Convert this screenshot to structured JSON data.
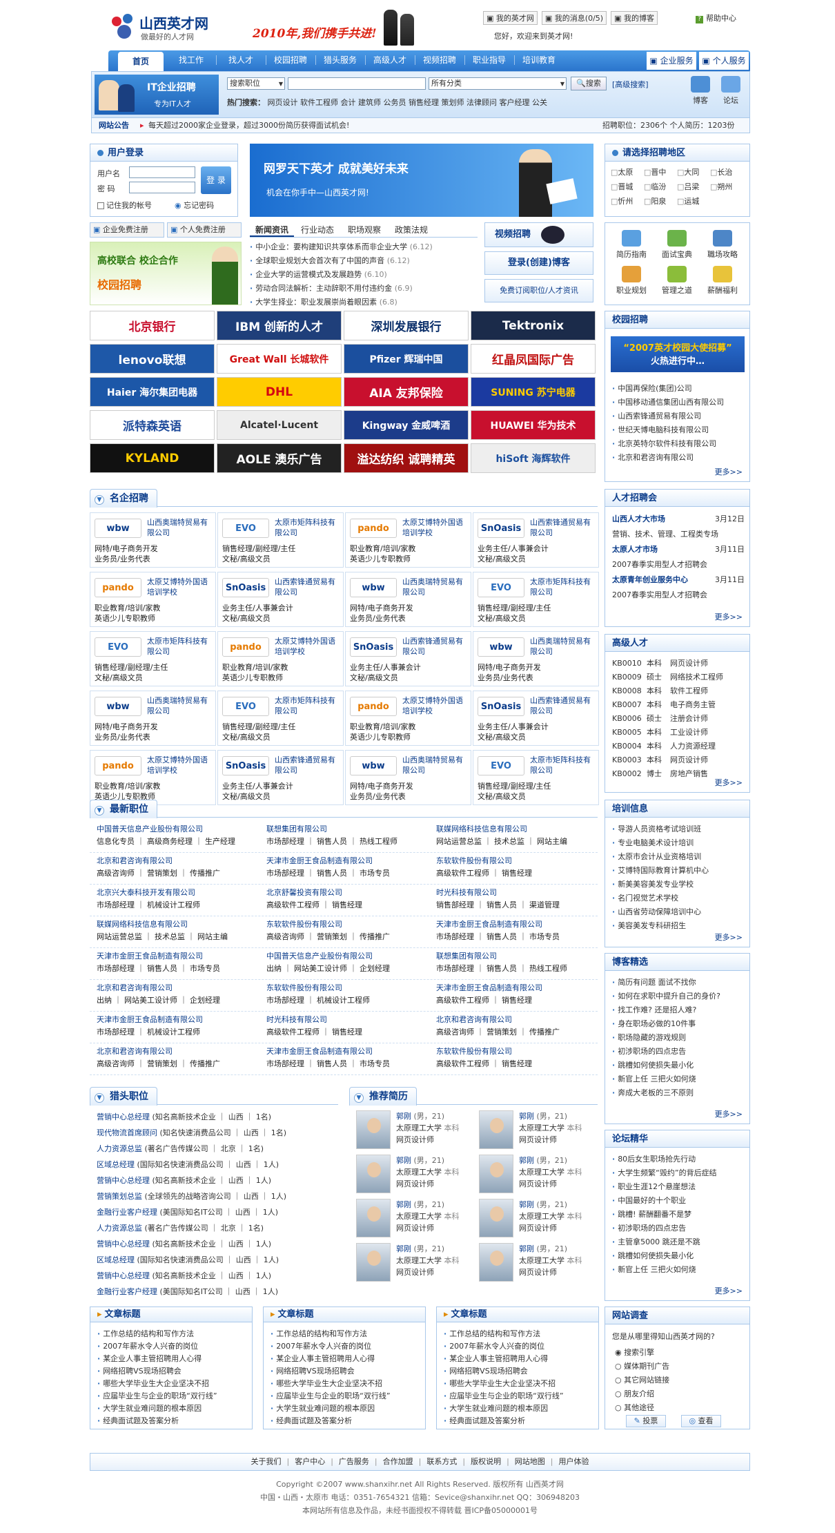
{
  "header": {
    "logo_text": "山西英才网",
    "slogan": "做最好的人才网",
    "banner_text": "2010年,我们携手共进!",
    "top_links": [
      "我的英才网",
      "我的消息(0/5)",
      "我的博客"
    ],
    "help": "帮助中心",
    "welcome": "您好，欢迎来到英才网!"
  },
  "nav": {
    "items": [
      "首页",
      "找工作",
      "找人才",
      "校园招聘",
      "猎头服务",
      "高级人才",
      "视频招聘",
      "职业指导",
      "培训教育"
    ],
    "right": [
      "企业服务",
      "个人服务"
    ]
  },
  "search": {
    "promo_title": "IT企业招聘",
    "promo_sub": "专为IT人才",
    "category": "搜索职位",
    "area": "所有分类",
    "button": "搜索",
    "advanced": "[高级搜索]",
    "hot_label": "热门搜索：",
    "hot": [
      "网页设计",
      "软件工程师",
      "会计",
      "建筑师",
      "公务员",
      "销售经理",
      "策划师",
      "法律顾问",
      "客户经理",
      "公关"
    ],
    "blog": "博客",
    "forum": "论坛"
  },
  "notice": {
    "label": "网站公告",
    "text": "每天超过2000家企业登录，超过3000份简历获得面试机会!",
    "stats": "招聘职位：2306个  个人简历：1203份"
  },
  "login": {
    "title": "用户登录",
    "user_label": "用户名",
    "pwd_label": "密  码",
    "button": "登 录",
    "remember": "记住我的帐号",
    "forgot": "忘记密码",
    "reg_company": "企业免费注册",
    "reg_person": "个人免费注册"
  },
  "banner": {
    "line1": "网罗天下英才  成就美好未来",
    "line2": "机会在你手中—山西英才网!"
  },
  "regions": {
    "title": "请选择招聘地区",
    "items": [
      "太原",
      "晋中",
      "大同",
      "长治",
      "晋城",
      "临汾",
      "吕梁",
      "朔州",
      "忻州",
      "阳泉",
      "运城"
    ]
  },
  "campus_promo": {
    "line1": "高校联合 校企合作",
    "line2": "校园招聘"
  },
  "news": {
    "tabs": [
      "新闻资讯",
      "行业动态",
      "职场观察",
      "政策法规"
    ],
    "items": [
      {
        "t": "中小企业：要构建知识共享体系而非企业大学",
        "d": "(6.12)"
      },
      {
        "t": "全球职业规划大会首次有了中国的声音",
        "d": "(6.12)"
      },
      {
        "t": "企业大学的运营模式及发展趋势",
        "d": "(6.10)"
      },
      {
        "t": "劳动合同法解析：主动辞职不用付违约金",
        "d": "(6.9)"
      },
      {
        "t": "大学生择业：职业发展崇尚着眼因素",
        "d": "(6.8)"
      }
    ]
  },
  "quick": {
    "video": "视频招聘",
    "login_blog": "登录(创建)博客",
    "subscribe": "免费订阅职位/人才资讯"
  },
  "tools": [
    "简历指南",
    "面试宝典",
    "職场攻略",
    "职业规划",
    "管理之道",
    "薪酬福利"
  ],
  "logos": [
    {
      "t": "北京银行",
      "c": "#c8102e",
      "bg": "#fff"
    },
    {
      "t": "IBM 创新的人才",
      "c": "#fff",
      "bg": "#1f3f7a"
    },
    {
      "t": "深圳发展银行",
      "c": "#0b2f6a",
      "bg": "#fff"
    },
    {
      "t": "Tektronix",
      "c": "#fff",
      "bg": "#1b2b4a"
    },
    {
      "t": "lenovo联想",
      "c": "#fff",
      "bg": "#1e58a8"
    },
    {
      "t": "Great Wall 长城软件",
      "c": "#d01010",
      "bg": "#fff"
    },
    {
      "t": "Pfizer 辉瑞中国",
      "c": "#fff",
      "bg": "#1b4f9e"
    },
    {
      "t": "红晶凤国际广告",
      "c": "#c01010",
      "bg": "#fff"
    },
    {
      "t": "Haier 海尔集团电器",
      "c": "#fff",
      "bg": "#1c57a8"
    },
    {
      "t": "DHL",
      "c": "#d40511",
      "bg": "#ffcc00"
    },
    {
      "t": "AIA 友邦保险",
      "c": "#fff",
      "bg": "#c8102e"
    },
    {
      "t": "SUNING 苏宁电器",
      "c": "#ffcc00",
      "bg": "#1b3aa0"
    },
    {
      "t": "派特森英语",
      "c": "#1d4a9a",
      "bg": "#fff"
    },
    {
      "t": "Alcatel·Lucent",
      "c": "#333",
      "bg": "#eee"
    },
    {
      "t": "Kingway 金威啤酒",
      "c": "#fff",
      "bg": "#1c3c8a"
    },
    {
      "t": "HUAWEI 华为技术",
      "c": "#fff",
      "bg": "#c8102e"
    },
    {
      "t": "KYLAND",
      "c": "#ffcc00",
      "bg": "#111"
    },
    {
      "t": "AOLE 澳乐广告",
      "c": "#fff",
      "bg": "#222"
    },
    {
      "t": "溢达纺织 诚聘精英",
      "c": "#fff",
      "bg": "#a01010"
    },
    {
      "t": "hiSoft 海辉软件",
      "c": "#1b4f9e",
      "bg": "#eee"
    }
  ],
  "famous": {
    "title": "名企招聘",
    "cards": [
      {
        "l": "wbw",
        "n": "山西奥瑞特贸易有限公司",
        "d1": "网特/电子商务开发",
        "d2": "业务员/业务代表"
      },
      {
        "l": "EVO",
        "n": "太原市矩阵科技有限公司",
        "d1": "销售经理/副经理/主任",
        "d2": "文秘/高级文员"
      },
      {
        "l": "pando",
        "n": "太原艾博特外国语培训学校",
        "d1": "职业教育/培训/家教",
        "d2": "英语少儿专职教师"
      },
      {
        "l": "SnOasis",
        "n": "山西索锋通贸易有限公司",
        "d1": "业务主任/人事兼会计",
        "d2": "文秘/高级文员"
      },
      {
        "l": "pando",
        "n": "太原艾博特外国语培训学校",
        "d1": "职业教育/培训/家教",
        "d2": "英语少儿专职教师"
      },
      {
        "l": "SnOasis",
        "n": "山西索锋通贸易有限公司",
        "d1": "业务主任/人事兼会计",
        "d2": "文秘/高级文员"
      },
      {
        "l": "wbw",
        "n": "山西奥瑞特贸易有限公司",
        "d1": "网特/电子商务开发",
        "d2": "业务员/业务代表"
      },
      {
        "l": "EVO",
        "n": "太原市矩阵科技有限公司",
        "d1": "销售经理/副经理/主任",
        "d2": "文秘/高级文员"
      },
      {
        "l": "EVO",
        "n": "太原市矩阵科技有限公司",
        "d1": "销售经理/副经理/主任",
        "d2": "文秘/高级文员"
      },
      {
        "l": "pando",
        "n": "太原艾博特外国语培训学校",
        "d1": "职业教育/培训/家教",
        "d2": "英语少儿专职教师"
      },
      {
        "l": "SnOasis",
        "n": "山西索锋通贸易有限公司",
        "d1": "业务主任/人事兼会计",
        "d2": "文秘/高级文员"
      },
      {
        "l": "wbw",
        "n": "山西奥瑞特贸易有限公司",
        "d1": "网特/电子商务开发",
        "d2": "业务员/业务代表"
      },
      {
        "l": "wbw",
        "n": "山西奥瑞特贸易有限公司",
        "d1": "网特/电子商务开发",
        "d2": "业务员/业务代表"
      },
      {
        "l": "EVO",
        "n": "太原市矩阵科技有限公司",
        "d1": "销售经理/副经理/主任",
        "d2": "文秘/高级文员"
      },
      {
        "l": "pando",
        "n": "太原艾博特外国语培训学校",
        "d1": "职业教育/培训/家教",
        "d2": "英语少儿专职教师"
      },
      {
        "l": "SnOasis",
        "n": "山西索锋通贸易有限公司",
        "d1": "业务主任/人事兼会计",
        "d2": "文秘/高级文员"
      },
      {
        "l": "pando",
        "n": "太原艾博特外国语培训学校",
        "d1": "职业教育/培训/家教",
        "d2": "英语少儿专职教师"
      },
      {
        "l": "SnOasis",
        "n": "山西索锋通贸易有限公司",
        "d1": "业务主任/人事兼会计",
        "d2": "文秘/高级文员"
      },
      {
        "l": "wbw",
        "n": "山西奥瑞特贸易有限公司",
        "d1": "网特/电子商务开发",
        "d2": "业务员/业务代表"
      },
      {
        "l": "EVO",
        "n": "太原市矩阵科技有限公司",
        "d1": "销售经理/副经理/主任",
        "d2": "文秘/高级文员"
      }
    ]
  },
  "latest": {
    "title": "最新职位",
    "rows": [
      [
        {
          "c": "中国普天信息产业股份有限公司",
          "p": "信息化专员 ｜ 高级商务经理 ｜ 生产经理"
        },
        {
          "c": "联想集团有限公司",
          "p": "市场部经理 ｜ 销售人员 ｜ 热线工程师"
        },
        {
          "c": "联媒网络科技信息有限公司",
          "p": "网站运营总监 ｜ 技术总监 ｜ 网站主编"
        }
      ],
      [
        {
          "c": "北京和君咨询有限公司",
          "p": "高级咨询师 ｜ 营销策划 ｜ 传播推广"
        },
        {
          "c": "天津市金厨王食品制造有限公司",
          "p": "市场部经理 ｜ 销售人员 ｜ 市场专员"
        },
        {
          "c": "东软软件股份有限公司",
          "p": "高级软件工程师 ｜ 销售经理"
        }
      ],
      [
        {
          "c": "北京兴大泰科技开发有限公司",
          "p": "市场部经理 ｜ 机械设计工程师"
        },
        {
          "c": "北京舒馨投资有限公司",
          "p": "高级软件工程师 ｜ 销售经理"
        },
        {
          "c": "时光科技有限公司",
          "p": "销售部经理 ｜ 销售人员 ｜ 渠道管理"
        }
      ],
      [
        {
          "c": "联媒网络科技信息有限公司",
          "p": "网站运营总监 ｜ 技术总监 ｜ 网站主编"
        },
        {
          "c": "东软软件股份有限公司",
          "p": "高级咨询师 ｜ 营销策划 ｜ 传播推广"
        },
        {
          "c": "天津市金厨王食品制造有限公司",
          "p": "市场部经理 ｜ 销售人员 ｜ 市场专员"
        }
      ],
      [
        {
          "c": "天津市金厨王食品制造有限公司",
          "p": "市场部经理 ｜ 销售人员 ｜ 市场专员"
        },
        {
          "c": "中国普天信息产业股份有限公司",
          "p": "出纳 ｜ 网站美工设计师 ｜ 企划经理"
        },
        {
          "c": "联想集团有限公司",
          "p": "市场部经理 ｜ 销售人员 ｜ 热线工程师"
        }
      ],
      [
        {
          "c": "北京和君咨询有限公司",
          "p": "出纳 ｜ 网站美工设计师 ｜ 企划经理"
        },
        {
          "c": "东软软件股份有限公司",
          "p": "市场部经理 ｜ 机械设计工程师"
        },
        {
          "c": "天津市金厨王食品制造有限公司",
          "p": "高级软件工程师 ｜ 销售经理"
        }
      ],
      [
        {
          "c": "天津市金厨王食品制造有限公司",
          "p": "市场部经理 ｜ 机械设计工程师"
        },
        {
          "c": "时光科技有限公司",
          "p": "高级软件工程师 ｜ 销售经理"
        },
        {
          "c": "北京和君咨询有限公司",
          "p": "高级咨询师 ｜ 营销策划 ｜ 传播推广"
        }
      ],
      [
        {
          "c": "北京和君咨询有限公司",
          "p": "高级咨询师 ｜ 营销策划 ｜ 传播推广"
        },
        {
          "c": "天津市金厨王食品制造有限公司",
          "p": "市场部经理 ｜ 销售人员 ｜ 市场专员"
        },
        {
          "c": "东软软件股份有限公司",
          "p": "高级软件工程师 ｜ 销售经理"
        }
      ]
    ]
  },
  "headhunt": {
    "title": "猎头职位",
    "items": [
      {
        "j": "营销中心总经理",
        "i": "(知名高新技术企业 ｜ 山西 ｜ 1名)"
      },
      {
        "j": "现代物流首席顾问",
        "i": "(知名快速消费品公司 ｜ 山西 ｜ 1名)"
      },
      {
        "j": "人力资源总监",
        "i": "(著名广告传媒公司 ｜ 北京 ｜ 1名)"
      },
      {
        "j": "区域总经理",
        "i": "(国际知名快速消费品公司 ｜ 山西 ｜ 1人)"
      },
      {
        "j": "营销中心总经理",
        "i": "(知名高新技术企业 ｜ 山西 ｜ 1人)"
      },
      {
        "j": "营销策划总监",
        "i": "(全球领先的战略咨询公司 ｜ 山西 ｜ 1人)"
      },
      {
        "j": "金融行业客户经理",
        "i": "(美国际知名IT公司 ｜ 山西 ｜ 1人)"
      },
      {
        "j": "人力资源总监",
        "i": "(著名广告传媒公司 ｜ 北京 ｜ 1名)"
      },
      {
        "j": "营销中心总经理",
        "i": "(知名高新技术企业 ｜ 山西 ｜ 1人)"
      },
      {
        "j": "区域总经理",
        "i": "(国际知名快速消费品公司 ｜ 山西 ｜ 1人)"
      },
      {
        "j": "营销中心总经理",
        "i": "(知名高新技术企业 ｜ 山西 ｜ 1人)"
      },
      {
        "j": "金融行业客户经理",
        "i": "(美国际知名IT公司 ｜ 山西 ｜ 1人)"
      }
    ]
  },
  "resumes": {
    "title": "推荐简历",
    "name": "郭刚",
    "info": "(男，21)",
    "school": "太原理工大学",
    "degree": "本科",
    "job": "网页设计师"
  },
  "articles": {
    "title": "文章标题",
    "items": [
      "工作总结的结构和写作方法",
      "2007年薪水令人兴奋的岗位",
      "某企业人事主管招聘用人心得",
      "网络招聘VS现场招聘会",
      "哪些大学毕业生大企业坚决不招",
      "应届毕业生与企业的职场“双行线”",
      "大学生就业难问题的根本原因",
      "经典面试题及答案分析"
    ]
  },
  "side_campus": {
    "title": "校园招聘",
    "promo1": "“2007英才校园大使招募”",
    "promo2": "火热进行中…",
    "items": [
      "中国再保险(集团)公司",
      "中国移动通信集团山西有限公司",
      "山西索锋通贸易有限公司",
      "世纪天博电脑科技有限公司",
      "北京英特尔软件科技有限公司",
      "北京和君咨询有限公司"
    ],
    "more": "更多>>"
  },
  "fairs": {
    "title": "人才招聘会",
    "items": [
      {
        "t": "山西人才大市场",
        "d": "3月12日",
        "s": "营销、技术、管理、工程类专场"
      },
      {
        "t": "太原人才市场",
        "d": "3月11日",
        "s": "2007春季实用型人才招聘会"
      },
      {
        "t": "太原青年创业服务中心",
        "d": "3月11日",
        "s": "2007春季实用型人才招聘会"
      }
    ],
    "more": "更多>>"
  },
  "senior": {
    "title": "高级人才",
    "items": [
      [
        "KB0010",
        "本科",
        "网页设计师"
      ],
      [
        "KB0009",
        "硕士",
        "网络技术工程师"
      ],
      [
        "KB0008",
        "本科",
        "软件工程师"
      ],
      [
        "KB0007",
        "本科",
        "电子商务主管"
      ],
      [
        "KB0006",
        "硕士",
        "注册会计师"
      ],
      [
        "KB0005",
        "本科",
        "工业设计师"
      ],
      [
        "KB0004",
        "本科",
        "人力资源经理"
      ],
      [
        "KB0003",
        "本科",
        "网页设计师"
      ],
      [
        "KB0002",
        "博士",
        "房地产销售"
      ]
    ],
    "more": "更多>>"
  },
  "training": {
    "title": "培训信息",
    "items": [
      "导游人员资格考试培训班",
      "专业电脑美术设计培训",
      "太原市会计从业资格培训",
      "艾博特国际教育计算机中心",
      "新美美容美发专业学校",
      "名门视觉艺术学校",
      "山西省劳动保障培训中心",
      "美容美发专科研招生"
    ],
    "more": "更多>>"
  },
  "blogs": {
    "title": "博客精选",
    "items": [
      "简历有问题 面试不找你",
      "如何在求职中提升自己的身价?",
      "找工作难? 还是招人难?",
      "身在职场必做的10件事",
      "职场隐藏的游戏规则",
      "初涉职场的四点忠告",
      "跳槽如何使损失最小化",
      "新官上任 三把火如何烧",
      "奔成大老板的三不原则"
    ],
    "more": "更多>>"
  },
  "forum": {
    "title": "论坛精华",
    "items": [
      "80后女生职场抢先行动",
      "大学生频繁“毁约”的背后症结",
      "职业生涯12个悬崖想法",
      "中国最好的十个职业",
      "跳槽! 薪酬翻番不是梦",
      "初涉职场的四点忠告",
      "主管拿5000 跳还是不跳",
      "跳槽如何使损失最小化",
      "新官上任 三把火如何烧"
    ],
    "more": "更多>>"
  },
  "survey": {
    "title": "网站调查",
    "question": "您是从哪里得知山西英才网的?",
    "options": [
      "搜索引擎",
      "媒体期刊广告",
      "其它网站链接",
      "朋友介绍",
      "其他途径"
    ],
    "vote": "投票",
    "view": "查看"
  },
  "footer": {
    "links": [
      "关于我们",
      "客户中心",
      "广告服务",
      "合作加盟",
      "联系方式",
      "版权说明",
      "网站地图",
      "用户体验"
    ],
    "line1": "Copyright ©2007  www.shanxihr.net All Rights Reserved.  版权所有 山西英才网",
    "line2": "中国・山西・太原市  电话：0351-7654321  信箱：Sevice@shanxihr.net  QQ：306948203",
    "line3": "本网站所有信息及作品，未经书面授权不得转载  晋ICP备05000001号"
  },
  "colors": {
    "nav": "#2f7fd3",
    "primary": "#0b3c8a",
    "border": "#a9c8ea"
  }
}
